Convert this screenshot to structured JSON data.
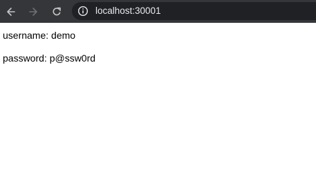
{
  "browser": {
    "url": "localhost:30001",
    "toolbar_bg": "#35363a",
    "address_bg": "#202124"
  },
  "page": {
    "username_line": "username: demo",
    "password_line": "password: p@ssw0rd"
  }
}
